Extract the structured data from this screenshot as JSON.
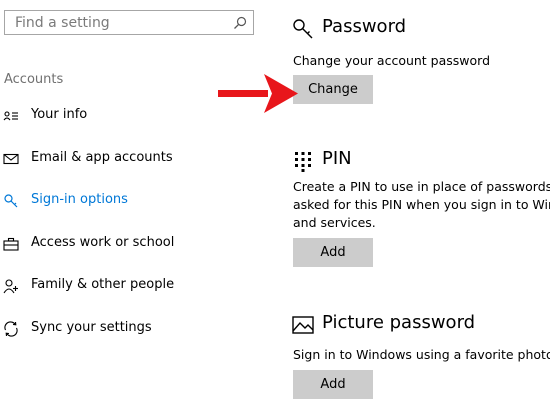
{
  "search": {
    "placeholder": "Find a setting",
    "icon": "search-icon"
  },
  "sidebar": {
    "section_title": "Accounts",
    "items": [
      {
        "label": "Your info",
        "icon": "person-card-icon",
        "active": false
      },
      {
        "label": "Email & app accounts",
        "icon": "mail-icon",
        "active": false
      },
      {
        "label": "Sign-in options",
        "icon": "key-icon",
        "active": true
      },
      {
        "label": "Access work or school",
        "icon": "briefcase-icon",
        "active": false
      },
      {
        "label": "Family & other people",
        "icon": "person-add-icon",
        "active": false
      },
      {
        "label": "Sync your settings",
        "icon": "sync-icon",
        "active": false
      }
    ]
  },
  "password": {
    "title": "Password",
    "description": "Change your account password",
    "button": "Change",
    "icon": "key-icon"
  },
  "pin": {
    "title": "PIN",
    "description_lines": [
      "Create a PIN to use in place of passwords. Yo",
      "asked for this PIN when you sign in to Wind",
      "and services."
    ],
    "button": "Add",
    "icon": "keypad-icon"
  },
  "picture_password": {
    "title": "Picture password",
    "description": "Sign in to Windows using a favorite photo",
    "button": "Add",
    "icon": "picture-icon"
  },
  "colors": {
    "accent": "#0078d7",
    "annotation_arrow": "#e8161b",
    "button_bg": "#cccccc"
  }
}
